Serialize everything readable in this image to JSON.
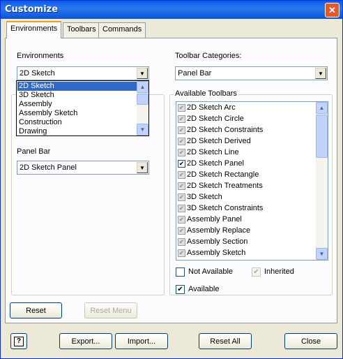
{
  "window": {
    "title": "Customize"
  },
  "tabs": [
    {
      "label": "Environments"
    },
    {
      "label": "Toolbars"
    },
    {
      "label": "Commands"
    }
  ],
  "environments": {
    "label": "Environments",
    "selected": "2D Sketch",
    "options": [
      "2D Sketch",
      "3D Sketch",
      "Assembly",
      "Assembly Sketch",
      "Construction",
      "Drawing"
    ]
  },
  "panel_bar": {
    "label": "Panel Bar",
    "value": "2D Sketch Panel"
  },
  "toolbar_categories": {
    "label": "Toolbar Categories:",
    "value": "Panel Bar"
  },
  "available_toolbars": {
    "label": "Available Toolbars",
    "items": [
      {
        "name": "2D Sketch Arc",
        "checked": false
      },
      {
        "name": "2D Sketch Circle",
        "checked": false
      },
      {
        "name": "2D Sketch Constraints",
        "checked": false
      },
      {
        "name": "2D Sketch Derived",
        "checked": false
      },
      {
        "name": "2D Sketch Line",
        "checked": false
      },
      {
        "name": "2D Sketch Panel",
        "checked": true
      },
      {
        "name": "2D Sketch Rectangle",
        "checked": false
      },
      {
        "name": "2D Sketch Treatments",
        "checked": false
      },
      {
        "name": "3D Sketch",
        "checked": false
      },
      {
        "name": "3D Sketch Constraints",
        "checked": false
      },
      {
        "name": "Assembly Panel",
        "checked": false
      },
      {
        "name": "Assembly Replace",
        "checked": false
      },
      {
        "name": "Assembly Section",
        "checked": false
      },
      {
        "name": "Assembly Sketch",
        "checked": false
      }
    ]
  },
  "legend": {
    "not_available": "Not Available",
    "inherited": "Inherited",
    "available": "Available"
  },
  "buttons": {
    "reset": "Reset",
    "reset_menu": "Reset Menu",
    "help": "?",
    "export": "Export...",
    "import": "Import...",
    "reset_all": "Reset All",
    "close": "Close"
  }
}
